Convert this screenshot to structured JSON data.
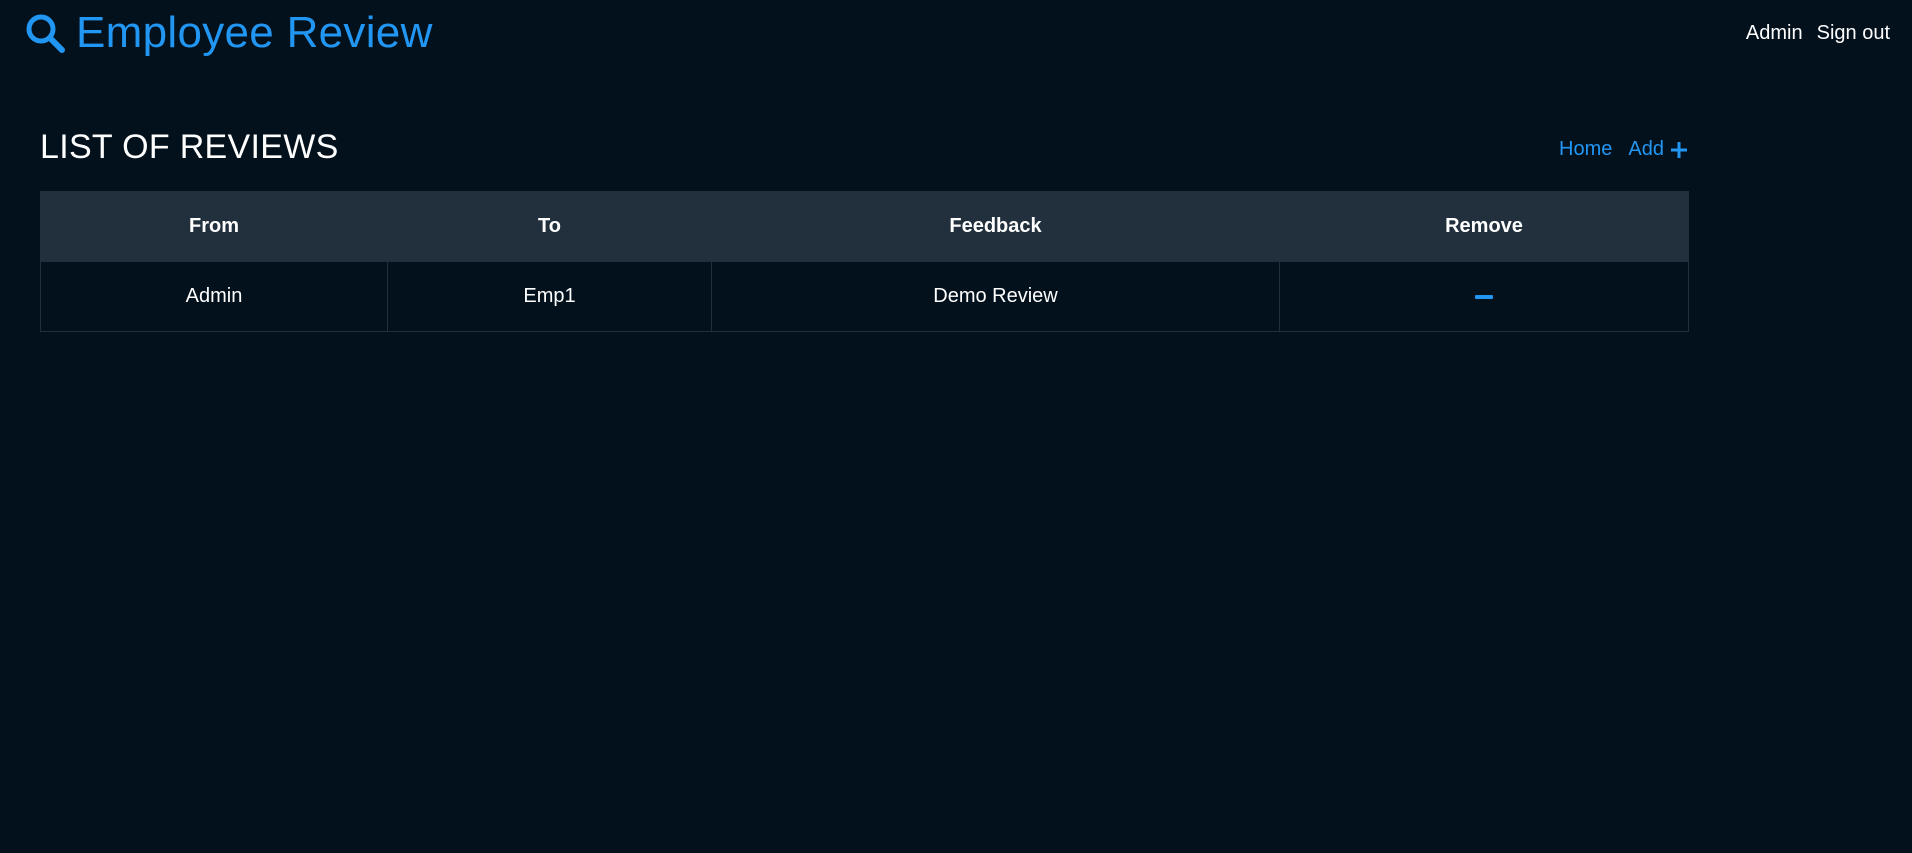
{
  "header": {
    "brand_icon": "search-icon",
    "brand_title": "Employee Review",
    "user_label": "Admin",
    "signout_label": "Sign out"
  },
  "page": {
    "title": "LIST OF REVIEWS",
    "home_label": "Home",
    "add_label": "Add",
    "add_icon": "plus-icon"
  },
  "table": {
    "columns": [
      "From",
      "To",
      "Feedback",
      "Remove"
    ],
    "rows": [
      {
        "from": "Admin",
        "to": "Emp1",
        "feedback": "Demo Review",
        "remove_icon": "minus-icon"
      }
    ]
  },
  "colors": {
    "background": "#03111c",
    "accent": "#2196f3",
    "table_header_bg": "#21303c",
    "border": "#1f2f3c",
    "text": "#ffffff"
  }
}
